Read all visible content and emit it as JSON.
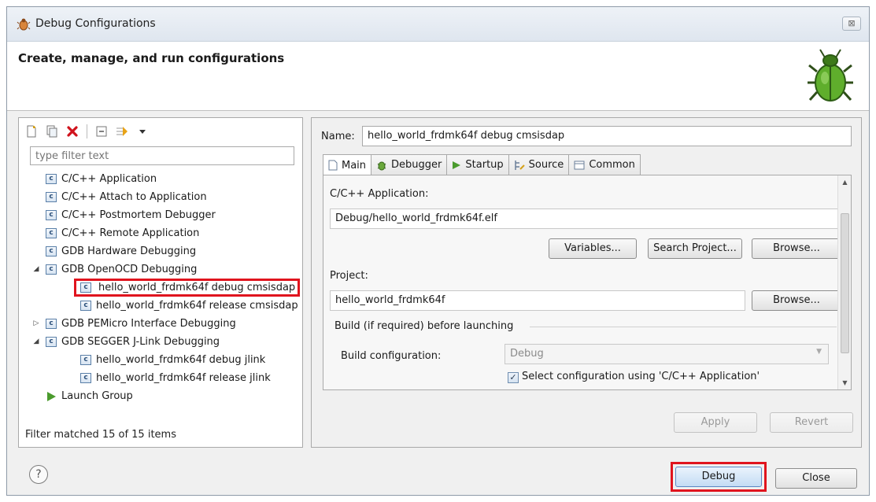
{
  "window": {
    "title": "Debug Configurations",
    "close_glyph": "⊠"
  },
  "banner": {
    "heading": "Create, manage, and run configurations",
    "icon": "bug-icon"
  },
  "left": {
    "toolbar_icons": [
      "new-config-icon",
      "duplicate-icon",
      "delete-icon",
      "collapse-all-icon",
      "filter-icon",
      "dropdown-icon"
    ],
    "filter_placeholder": "type filter text",
    "tree": [
      {
        "label": "C/C++ Application",
        "level": 1,
        "icon": "c-config-icon"
      },
      {
        "label": "C/C++ Attach to Application",
        "level": 1,
        "icon": "c-config-icon"
      },
      {
        "label": "C/C++ Postmortem Debugger",
        "level": 1,
        "icon": "c-config-icon"
      },
      {
        "label": "C/C++ Remote Application",
        "level": 1,
        "icon": "c-config-icon"
      },
      {
        "label": "GDB Hardware Debugging",
        "level": 1,
        "icon": "c-config-icon"
      },
      {
        "label": "GDB OpenOCD Debugging",
        "level": 1,
        "icon": "c-config-icon",
        "expanded": true
      },
      {
        "label": "hello_world_frdmk64f debug cmsisdap",
        "level": 2,
        "icon": "c-config-icon",
        "selected": true
      },
      {
        "label": "hello_world_frdmk64f release cmsisdap",
        "level": 2,
        "icon": "c-config-icon"
      },
      {
        "label": "GDB PEMicro Interface Debugging",
        "level": 1,
        "icon": "c-config-icon",
        "collapsed": true
      },
      {
        "label": "GDB SEGGER J-Link Debugging",
        "level": 1,
        "icon": "c-config-icon",
        "expanded": true
      },
      {
        "label": "hello_world_frdmk64f debug jlink",
        "level": 2,
        "icon": "c-config-icon"
      },
      {
        "label": "hello_world_frdmk64f release jlink",
        "level": 2,
        "icon": "c-config-icon"
      },
      {
        "label": "Launch Group",
        "level": 1,
        "icon": "launch-group-icon"
      }
    ],
    "filter_status": "Filter matched 15 of 15 items"
  },
  "right": {
    "name_label": "Name:",
    "name_value": "hello_world_frdmk64f debug cmsisdap",
    "tabs": [
      {
        "label": "Main",
        "icon": "main-tab-icon",
        "active": true
      },
      {
        "label": "Debugger",
        "icon": "debugger-tab-icon"
      },
      {
        "label": "Startup",
        "icon": "startup-tab-icon"
      },
      {
        "label": "Source",
        "icon": "source-tab-icon"
      },
      {
        "label": "Common",
        "icon": "common-tab-icon"
      }
    ],
    "main": {
      "app_label": "C/C++ Application:",
      "app_value": "Debug/hello_world_frdmk64f.elf",
      "variables_button": "Variables...",
      "search_project_button": "Search Project...",
      "browse_button": "Browse...",
      "project_label": "Project:",
      "project_value": "hello_world_frdmk64f",
      "project_browse_button": "Browse...",
      "build_group_label": "Build (if required) before launching",
      "build_config_label": "Build configuration:",
      "build_config_value": "Debug",
      "select_config_label": "Select configuration using 'C/C++ Application'",
      "select_config_checked": true
    },
    "apply_button": "Apply",
    "revert_button": "Revert"
  },
  "bottom": {
    "help_glyph": "?",
    "debug_button": "Debug",
    "close_button": "Close"
  },
  "colors": {
    "highlight_red": "#e0141e",
    "launch_green": "#4a9b2d"
  }
}
